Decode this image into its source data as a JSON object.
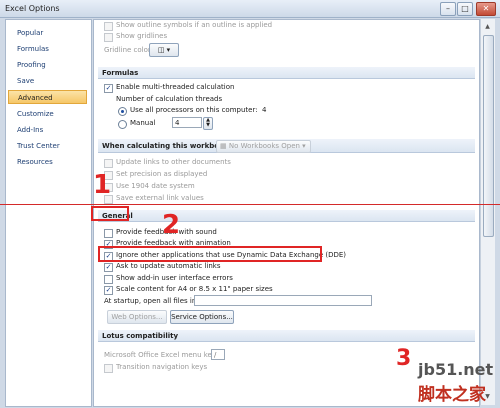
{
  "window": {
    "title": "Excel Options",
    "minimize": "–",
    "maximize": "□",
    "close": "✕"
  },
  "sidebar": {
    "items": [
      {
        "label": "Popular"
      },
      {
        "label": "Formulas"
      },
      {
        "label": "Proofing"
      },
      {
        "label": "Save"
      },
      {
        "label": "Advanced",
        "active": true
      },
      {
        "label": "Customize"
      },
      {
        "label": "Add-Ins"
      },
      {
        "label": "Trust Center"
      },
      {
        "label": "Resources"
      }
    ]
  },
  "display_top": {
    "outline_symbols": "Show outline symbols if an outline is applied",
    "gridlines": "Show gridlines",
    "gridline_color_label": "Gridline color"
  },
  "formulas": {
    "header": "Formulas",
    "multithread": "Enable multi-threaded calculation",
    "threads_label": "Number of calculation threads",
    "use_all": "Use all processors on this computer:",
    "processor_count": "4",
    "manual": "Manual",
    "manual_value": "4"
  },
  "workbook": {
    "header": "When calculating this workbook:",
    "selected": "No Workbooks Open",
    "update_links": "Update links to other documents",
    "precision": "Set precision as displayed",
    "date1904": "Use 1904 date system",
    "save_links": "Save external link values"
  },
  "general": {
    "header": "General",
    "feedback_sound": "Provide feedback with sound",
    "feedback_animation": "Provide feedback with animation",
    "ignore_dde": "Ignore other applications that use Dynamic Data Exchange (DDE)",
    "ask_update": "Ask to update automatic links",
    "addin_errors": "Show add-in user interface errors",
    "scale_content": "Scale content for A4 or 8.5 x 11\" paper sizes",
    "startup_label": "At startup, open all files in:",
    "startup_value": "",
    "web_options": "Web Options...",
    "service_options": "Service Options..."
  },
  "lotus": {
    "header": "Lotus compatibility",
    "menu_key": "Microsoft Office Excel menu key:",
    "menu_key_value": "/",
    "transition_keys": "Transition navigation keys"
  },
  "annotations": {
    "step1": "1",
    "step2": "2",
    "step3": "3"
  },
  "watermark": {
    "site": "jb51.net",
    "brand": "脚本之家"
  },
  "colors": {
    "annotation_red": "#e02525",
    "active_nav": "#f6c768"
  }
}
